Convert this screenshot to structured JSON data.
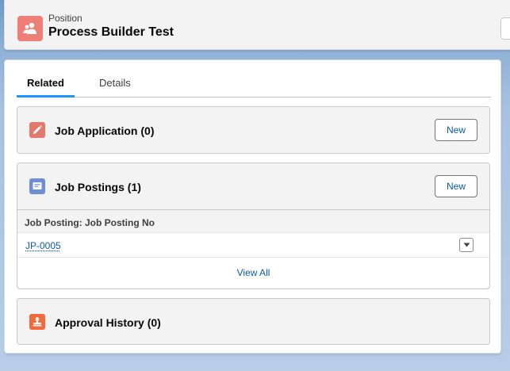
{
  "header": {
    "object_type": "Position",
    "record_name": "Process Builder Test",
    "icon": "position-people-icon"
  },
  "tabs": [
    {
      "label": "Related",
      "active": true
    },
    {
      "label": "Details",
      "active": false
    }
  ],
  "related_lists": {
    "job_application": {
      "title": "Job Application (0)",
      "icon": "pencil-icon",
      "icon_color": "#e07a6c",
      "new_label": "New"
    },
    "job_postings": {
      "title": "Job Postings (1)",
      "icon": "document-icon",
      "icon_color": "#6e8fd6",
      "new_label": "New",
      "column_header": "Job Posting: Job Posting No",
      "rows": [
        {
          "value": "JP-0005"
        }
      ],
      "view_all": "View All"
    },
    "approval_history": {
      "title": "Approval History (0)",
      "icon": "stamp-icon",
      "icon_color": "#f26a3c"
    }
  },
  "colors": {
    "link": "#0b5cab",
    "tab_active_underline": "#1b96ff",
    "position_icon": "#ef7e76"
  }
}
